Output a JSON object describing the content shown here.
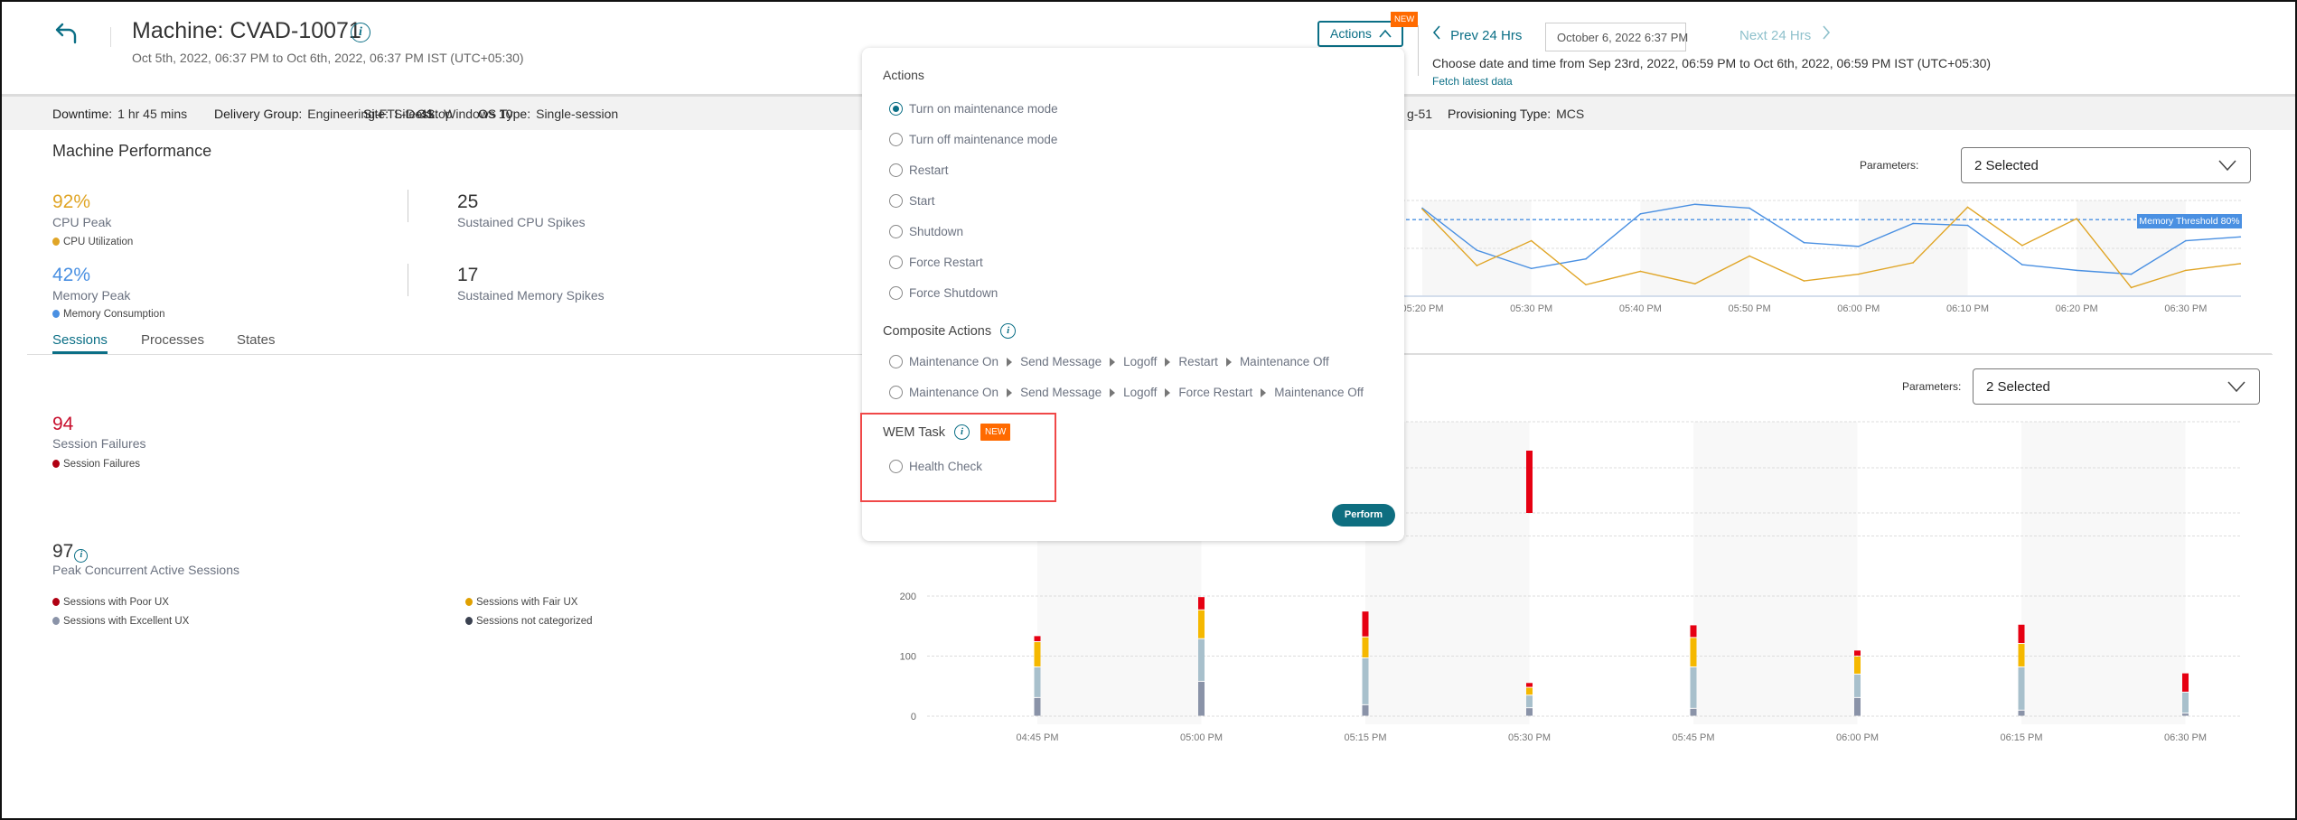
{
  "header": {
    "title": "Machine: CVAD-10071",
    "subtitle": "Oct 5th, 2022, 06:37 PM to Oct 6th, 2022, 06:37 PM IST (UTC+05:30)",
    "back_icon": "arrow-back-icon",
    "info_icon": "info-icon"
  },
  "actions": {
    "label": "Actions",
    "new_badge": "NEW"
  },
  "time_nav": {
    "prev": "Prev 24 Hrs",
    "date_value": "October 6, 2022 6:37 PM",
    "next": "Next 24 Hrs",
    "range_text": "Choose date and time from Sep 23rd, 2022, 06:59 PM to Oct 6th, 2022, 06:59 PM IST (UTC+05:30)",
    "fetch": "Fetch latest data"
  },
  "info_bar": [
    {
      "label": "Downtime:",
      "value": "1 hr 45 mins"
    },
    {
      "label": "Delivery Group:",
      "value": "Engineering-FTL-Desktop"
    },
    {
      "label": "Site:",
      "value": "Site-41"
    },
    {
      "label": "OS:",
      "value": "Windows 10"
    },
    {
      "label": "OS Type:",
      "value": "Single-session"
    },
    {
      "label": "",
      "value": "g-51"
    },
    {
      "label": "Provisioning Type:",
      "value": "MCS"
    }
  ],
  "performance": {
    "title": "Machine Performance",
    "cpu_peak_value": "92%",
    "cpu_peak_label": "CPU Peak",
    "cpu_legend": "CPU Utilization",
    "cpu_spikes_value": "25",
    "cpu_spikes_label": "Sustained CPU Spikes",
    "mem_peak_value": "42%",
    "mem_peak_label": "Memory Peak",
    "mem_legend": "Memory Consumption",
    "mem_spikes_value": "17",
    "mem_spikes_label": "Sustained Memory Spikes"
  },
  "tabs": [
    {
      "label": "Sessions",
      "active": true
    },
    {
      "label": "Processes",
      "active": false
    },
    {
      "label": "States",
      "active": false
    }
  ],
  "sessions": {
    "failures_value": "94",
    "failures_label": "Session Failures",
    "failures_legend": "Session Failures",
    "peak_value": "97",
    "peak_label": "Peak Concurrent Active Sessions",
    "legend": [
      {
        "label": "Sessions with Poor UX",
        "color": "#b00012"
      },
      {
        "label": "Sessions with Fair UX",
        "color": "#e0a000"
      },
      {
        "label": "Sessions with Excellent UX",
        "color": "#8a93a8"
      },
      {
        "label": "Sessions not categorized",
        "color": "#3a4150"
      }
    ]
  },
  "parameters": [
    {
      "label": "Parameters:",
      "value": "2 Selected"
    },
    {
      "label": "Parameters:",
      "value": "2 Selected"
    }
  ],
  "popup": {
    "title": "Actions",
    "items": [
      "Turn on maintenance mode",
      "Turn off maintenance mode",
      "Restart",
      "Start",
      "Shutdown",
      "Force Restart",
      "Force Shutdown"
    ],
    "selected": "Turn on maintenance mode",
    "composite_title": "Composite Actions",
    "composite_items": [
      [
        "Maintenance On",
        "Send Message",
        "Logoff",
        "Restart",
        "Maintenance Off"
      ],
      [
        "Maintenance On",
        "Send Message",
        "Logoff",
        "Force Restart",
        "Maintenance Off"
      ]
    ],
    "wem_title": "WEM Task",
    "wem_badge": "NEW",
    "wem_items": [
      "Health Check"
    ],
    "perform": "Perform"
  },
  "colors": {
    "accent": "#0b6f86",
    "new_badge": "#ff6a00",
    "cpu": "#e0a526",
    "memory": "#4a90e2",
    "failures": "#c8102e",
    "highlight_box": "#f04848"
  },
  "chart_data": [
    {
      "type": "line",
      "x": [
        "05:20 PM",
        "05:25 PM",
        "05:30 PM",
        "05:35 PM",
        "05:40 PM",
        "05:45 PM",
        "05:50 PM",
        "05:55 PM",
        "06:00 PM",
        "06:05 PM",
        "06:10 PM",
        "06:15 PM",
        "06:20 PM",
        "06:25 PM",
        "06:30 PM",
        "06:35 PM"
      ],
      "x_ticks": [
        "05:20 PM",
        "05:30 PM",
        "05:40 PM",
        "05:50 PM",
        "06:00 PM",
        "06:10 PM",
        "06:20 PM",
        "06:30 PM"
      ],
      "series": [
        {
          "name": "Memory Consumption",
          "color": "#4a90e2",
          "values": [
            92,
            48,
            29,
            39,
            86,
            96,
            92,
            56,
            52,
            76,
            74,
            33,
            27,
            23,
            58,
            62
          ]
        },
        {
          "name": "CPU Utilization",
          "color": "#e0a526",
          "values": [
            91,
            32,
            58,
            12,
            26,
            13,
            42,
            16,
            23,
            35,
            93,
            53,
            81,
            9,
            27,
            34
          ]
        }
      ],
      "ylim": [
        0,
        100
      ],
      "threshold": {
        "label": "Memory Threshold 80%",
        "value": 80
      },
      "grid": true
    },
    {
      "type": "bar",
      "categories": [
        "05:30 PM"
      ],
      "series": [
        {
          "name": "Session Failures",
          "color": "#e60012",
          "values": [
            94
          ]
        }
      ],
      "grid": true
    },
    {
      "type": "bar",
      "stacked": true,
      "categories": [
        "04:45 PM",
        "05:00 PM",
        "05:15 PM",
        "05:30 PM",
        "05:45 PM",
        "06:00 PM",
        "06:15 PM",
        "06:30 PM"
      ],
      "y_ticks": [
        0,
        100,
        200
      ],
      "ylim": [
        0,
        300
      ],
      "series": [
        {
          "name": "Sessions not categorized",
          "color": "#8a93a8",
          "values": [
            31,
            58,
            19,
            14,
            13,
            31,
            10,
            5
          ]
        },
        {
          "name": "Sessions with Excellent UX",
          "color": "#a8c0cc",
          "values": [
            51,
            71,
            78,
            21,
            69,
            39,
            72,
            35
          ]
        },
        {
          "name": "Sessions with Fair UX",
          "color": "#f5b800",
          "values": [
            42,
            48,
            35,
            13,
            49,
            30,
            39,
            0
          ]
        },
        {
          "name": "Sessions with Poor UX",
          "color": "#e60012",
          "values": [
            10,
            22,
            43,
            8,
            21,
            10,
            32,
            32
          ]
        }
      ],
      "grid": true
    }
  ]
}
